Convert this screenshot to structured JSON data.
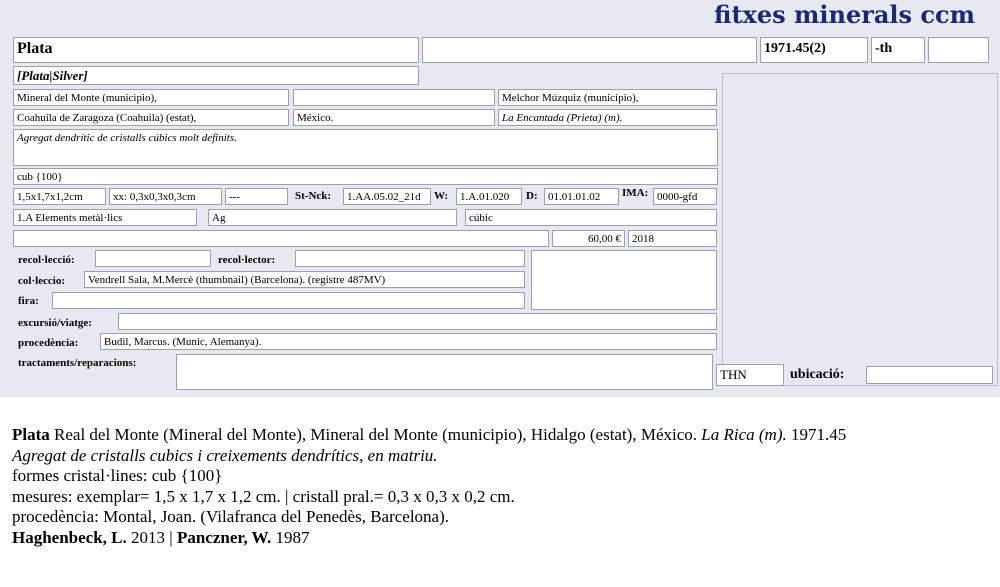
{
  "brand": "fitxes minerals ccm",
  "record": {
    "name": "Plata",
    "field_blank_1": "",
    "catalog": "1971.45(2)",
    "suffix": "-th",
    "field_blank_2": "",
    "synonym": "[Plata|Silver]",
    "loc1": "Mineral del Monte (municipio),",
    "loc1b": "",
    "loc1c": "Melchor Múzquiz (municipio),",
    "loc2": "Coahuila de Zaragoza (Coahuila) (estat),",
    "loc2b": "México.",
    "loc2c": "La Encantada (Prieta) (m).",
    "description": "Agregat dendrític de cristalls cúbics molt definits.",
    "forms": "cub {100}",
    "size": "1,5x1,7x1,2cm",
    "crystal_size": "xx: 0,3x0,3x0,3cm",
    "dash": "---",
    "stnck_label": "St-Nck:",
    "stnck": "1.AA.05.02_21d",
    "w_label": "W:",
    "w": "1.A.01.020",
    "d_label": "D:",
    "d": "01.01.01.02",
    "ima_label": "IMA:",
    "ima": "0000-gfd",
    "class": "1.A Elements metàl·lics",
    "formula": "Ag",
    "system": "cúbic",
    "blank_row": "",
    "price": "60,00 €",
    "year": "2018",
    "recoleccio_label": "recol·lecció:",
    "recoleccio": "",
    "recolector_label": "recol·lector:",
    "recolector": "",
    "colleccio_label": "col·leccio:",
    "colleccio": "Vendrell Sala, M.Mercè (thumbnail) (Barcelona). (registre 487MV)",
    "fira_label": "fira:",
    "fira": "",
    "excursio_label": "excursió/viatge:",
    "excursio": "",
    "procedencia_label": "procedència:",
    "procedencia": "Budil, Marcus. (Munic, Alemanya).",
    "tractaments_label": "tractaments/reparacions:",
    "tractaments": "",
    "thn": "THN",
    "ubicacio_label": "ubicació:",
    "ubicacio": ""
  },
  "caption": {
    "name": "Plata",
    "locality": " Real del Monte (Mineral del Monte), Mineral del Monte (municipio), Hidalgo (estat), México. ",
    "locality_italic": "La Rica (m).",
    "catalog": " 1971.45",
    "description": "Agregat de cristalls cubics i creixements dendrítics, en matriu.",
    "forms": "formes cristal·lines: cub {100}",
    "measures": "mesures: exemplar= 1,5 x 1,7 x 1,2 cm. | cristall pral.= 0,3 x 0,3 x 0,2 cm.",
    "procedencia": "procedència: Montal, Joan. (Vilafranca del Penedès, Barcelona).",
    "ref1_author": "Haghenbeck, L.",
    "ref1_year": " 2013 | ",
    "ref2_author": "Panczner, W.",
    "ref2_year": " 1987"
  }
}
